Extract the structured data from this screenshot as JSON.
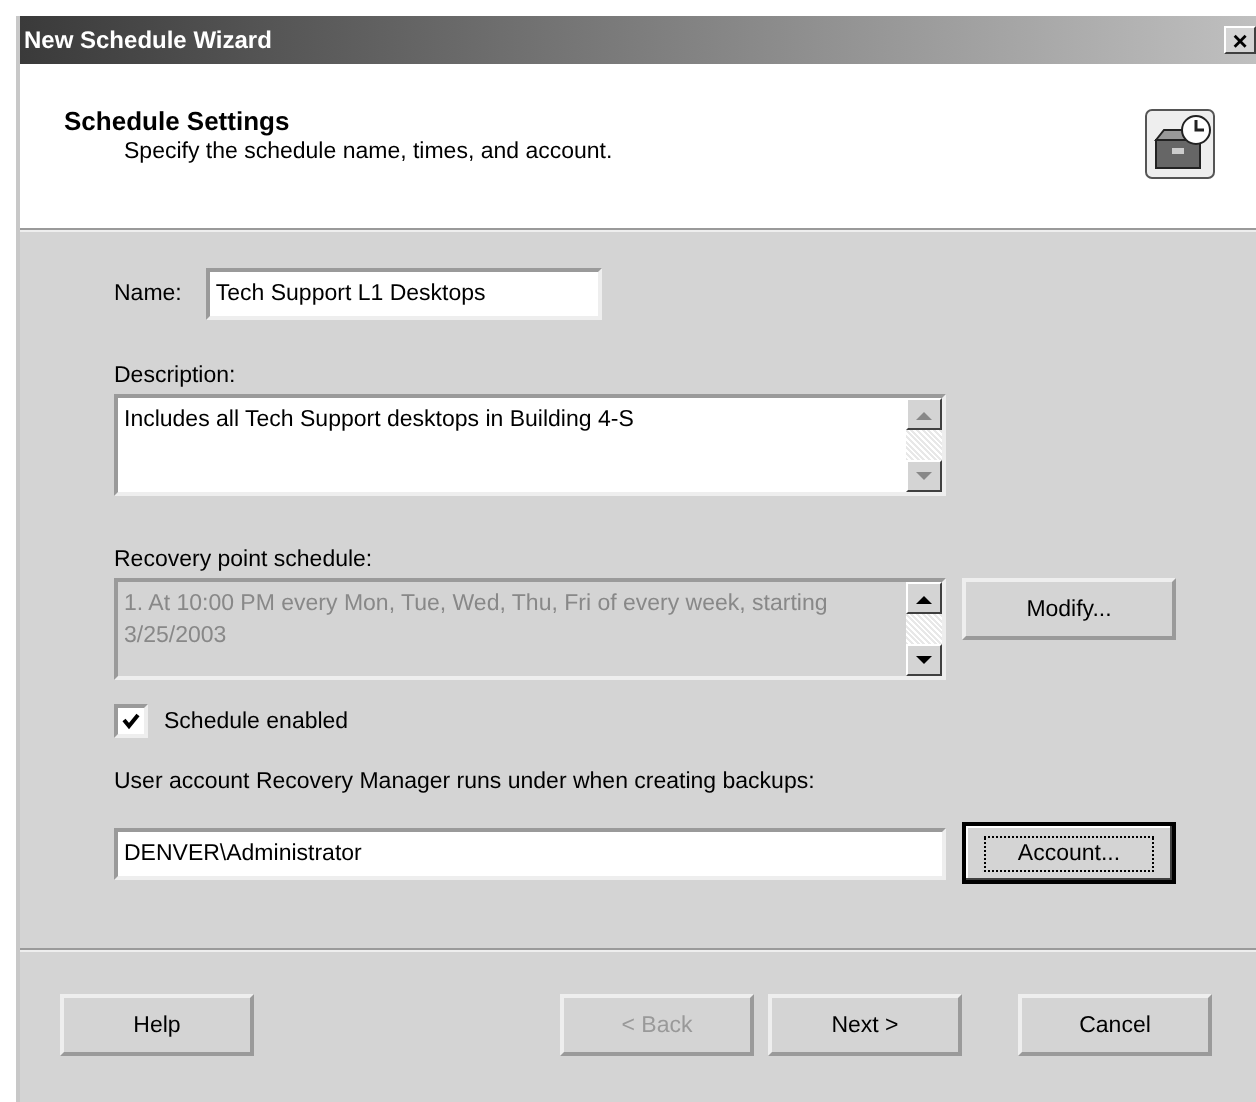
{
  "window": {
    "title": "New Schedule Wizard",
    "close_glyph": "×"
  },
  "header": {
    "title": "Schedule Settings",
    "subtitle": "Specify the schedule name, times, and account."
  },
  "name": {
    "label": "Name:",
    "value": "Tech Support L1 Desktops"
  },
  "description": {
    "label": "Description:",
    "value": "Includes all Tech Support desktops in Building 4-S"
  },
  "schedule": {
    "label": "Recovery point schedule:",
    "value": "1. At 10:00 PM every Mon, Tue, Wed, Thu, Fri of every week, starting 3/25/2003",
    "disabled": true,
    "button": "Modify..."
  },
  "enabled": {
    "label": "Schedule enabled",
    "checked": true
  },
  "account": {
    "label": "User account Recovery Manager runs under when creating backups:",
    "value": "DENVER\\Administrator",
    "button": "Account...",
    "focused": true
  },
  "buttons": [
    {
      "label": "Help",
      "disabled": false
    },
    {
      "label": "< Back",
      "disabled": true
    },
    {
      "label": "Next >",
      "disabled": false
    },
    {
      "label": "Cancel",
      "disabled": false
    }
  ]
}
